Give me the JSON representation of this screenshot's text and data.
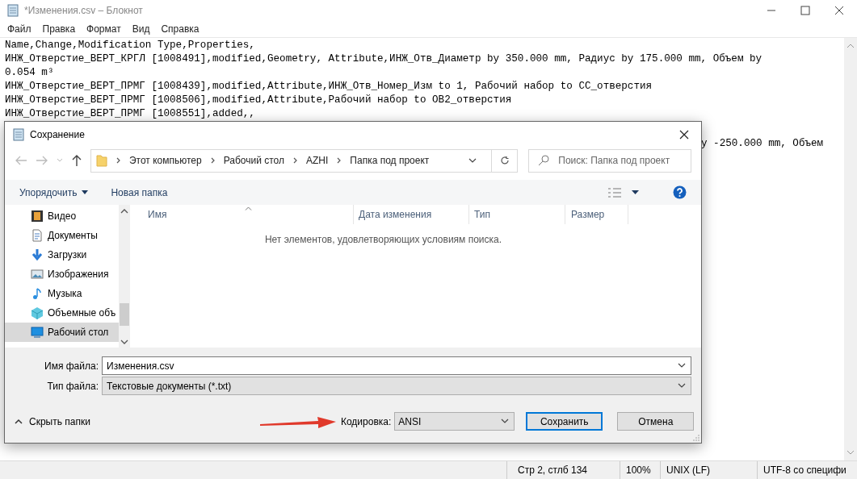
{
  "window": {
    "title": "*Изменения.csv – Блокнот",
    "menu": [
      "Файл",
      "Правка",
      "Формат",
      "Вид",
      "Справка"
    ]
  },
  "editor": {
    "lines": [
      "Name,Change,Modification Type,Properties,",
      "ИНЖ_Отверстие_ВЕРТ_КРГЛ [1008491],modified,Geometry, Attribute,ИНЖ_Отв_Диаметр by 350.000 mm, Радиус by 175.000 mm, Объем by",
      "0.054 m³",
      "ИНЖ_Отверстие_ВЕРТ_ПРМГ [1008439],modified,Attribute,ИНЖ_Отв_Номер_Изм to 1, Рабочий набор to СС_отверстия",
      "ИНЖ_Отверстие_ВЕРТ_ПРМГ [1008506],modified,Attribute,Рабочий набор to ОВ2_отверстия",
      "ИНЖ_Отверстие_ВЕРТ_ПРМГ [1008551],added,,"
    ],
    "covered_line_tail": "y -250.000 mm, Объем"
  },
  "status_bar": [
    "Стр 2, стлб 134",
    "100%",
    "UNIX (LF)",
    "UTF-8 со специфи"
  ],
  "save_dialog": {
    "title": "Сохранение",
    "breadcrumb": [
      "Этот компьютер",
      "Рабочий стол",
      "AZHI",
      "Папка под проект"
    ],
    "search_placeholder": "Поиск: Папка под проект",
    "toolbar": {
      "organize": "Упорядочить",
      "new_folder": "Новая папка"
    },
    "nav_items": [
      {
        "label": "Видео",
        "kind": "video",
        "selected": false
      },
      {
        "label": "Документы",
        "kind": "documents",
        "selected": false
      },
      {
        "label": "Загрузки",
        "kind": "downloads",
        "selected": false
      },
      {
        "label": "Изображения",
        "kind": "pictures",
        "selected": false
      },
      {
        "label": "Музыка",
        "kind": "music",
        "selected": false
      },
      {
        "label": "Объемные объ",
        "kind": "objects",
        "selected": false
      },
      {
        "label": "Рабочий стол",
        "kind": "desktop",
        "selected": true
      }
    ],
    "columns": [
      "Имя",
      "Дата изменения",
      "Тип",
      "Размер"
    ],
    "empty_message": "Нет элементов, удовлетворяющих условиям поиска.",
    "file_name": {
      "label": "Имя файла:",
      "value": "Изменения.csv"
    },
    "file_type": {
      "label": "Тип файла:",
      "value": "Текстовые документы (*.txt)"
    },
    "hide_folders": "Скрыть папки",
    "encoding": {
      "label": "Кодировка:",
      "value": "ANSI"
    },
    "buttons": [
      {
        "label": "Сохранить",
        "default": true
      },
      {
        "label": "Отмена",
        "default": false
      }
    ]
  }
}
